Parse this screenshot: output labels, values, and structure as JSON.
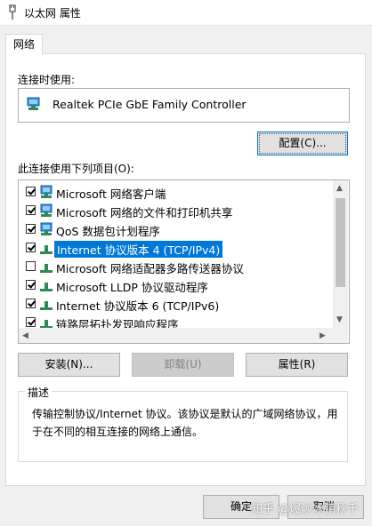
{
  "window": {
    "title": "以太网 属性"
  },
  "tabs": [
    {
      "label": "网络"
    }
  ],
  "connect_using": {
    "label": "连接时使用:",
    "adapter_name": "Realtek PCIe GbE Family Controller",
    "configure_button": "配置(C)..."
  },
  "items_section": {
    "label": "此连接使用下列项目(O):",
    "items": [
      {
        "label": "Microsoft 网络客户端",
        "checked": true,
        "icon": "network-client-icon"
      },
      {
        "label": "Microsoft 网络的文件和打印机共享",
        "checked": true,
        "icon": "file-share-icon"
      },
      {
        "label": "QoS 数据包计划程序",
        "checked": true,
        "icon": "qos-icon"
      },
      {
        "label": "Internet 协议版本 4 (TCP/IPv4)",
        "checked": true,
        "selected": true,
        "icon": "protocol-icon"
      },
      {
        "label": "Microsoft 网络适配器多路传送器协议",
        "checked": false,
        "icon": "protocol-icon"
      },
      {
        "label": "Microsoft LLDP 协议驱动程序",
        "checked": true,
        "icon": "protocol-icon"
      },
      {
        "label": "Internet 协议版本 6 (TCP/IPv6)",
        "checked": true,
        "icon": "protocol-icon"
      },
      {
        "label": "链路层拓扑发现响应程序",
        "checked": true,
        "icon": "protocol-icon"
      }
    ]
  },
  "buttons": {
    "install": "安装(N)...",
    "uninstall": "卸载(U)",
    "properties": "属性(R)"
  },
  "description": {
    "legend": "描述",
    "text": "传输控制协议/Internet 协议。该协议是默认的广域网络协议，用于在不同的相互连接的网络上通信。"
  },
  "footer": {
    "ok": "确定",
    "cancel": "取消"
  },
  "watermark": "知乎 @爆炒冰镇秋千",
  "colors": {
    "selection": "#0078d7",
    "focus_border": "#0078d7"
  }
}
